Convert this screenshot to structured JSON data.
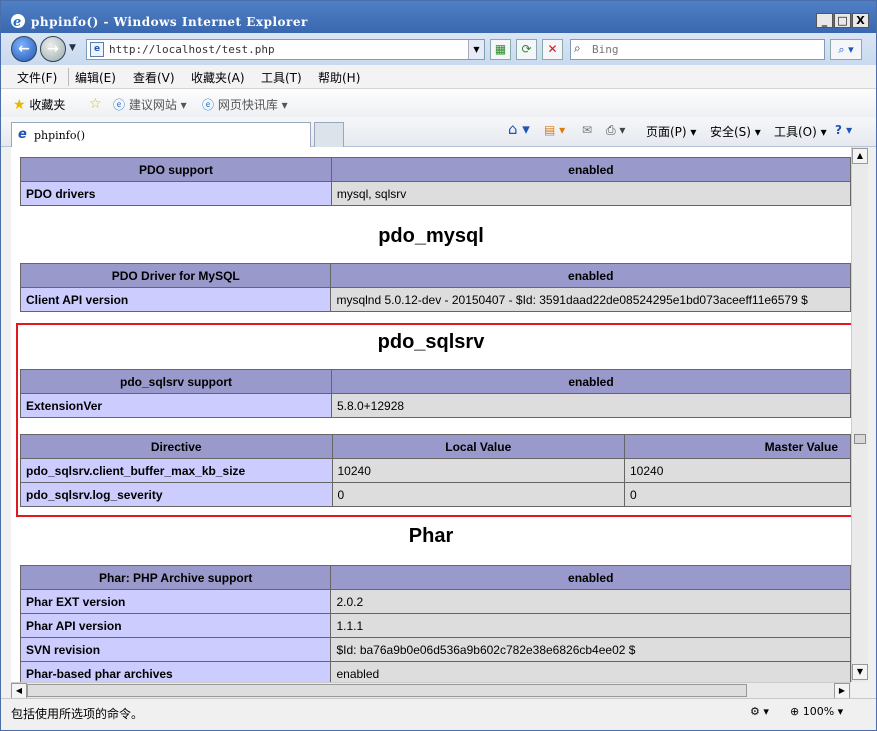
{
  "window": {
    "title": "phpinfo() - Windows Internet Explorer",
    "minimize": "_",
    "maximize": "□",
    "close": "X"
  },
  "address_bar": {
    "url": "http://localhost/test.php",
    "search_placeholder": "Bing"
  },
  "menu": [
    "文件(F)",
    "编辑(E)",
    "查看(V)",
    "收藏夹(A)",
    "工具(T)",
    "帮助(H)"
  ],
  "favorites_bar": {
    "favorites": "收藏夹",
    "suggested_sites": "建议网站 ▾",
    "web_slice": "网页快讯库 ▾"
  },
  "tab": {
    "label": "phpinfo()"
  },
  "command_bar": {
    "page": "页面(P) ▾",
    "safety": "安全(S) ▾",
    "tools": "工具(O) ▾"
  },
  "content": {
    "pdo_table": {
      "rows": [
        {
          "key": "PDO support",
          "value": "enabled",
          "header": true
        },
        {
          "key": "PDO drivers",
          "value": "mysql, sqlsrv"
        }
      ]
    },
    "pdo_mysql": {
      "heading": "pdo_mysql",
      "rows": [
        {
          "key": "PDO Driver for MySQL",
          "value": "enabled",
          "header": true
        },
        {
          "key": "Client API version",
          "value": "mysqlnd 5.0.12-dev - 20150407 - $Id: 3591daad22de08524295e1bd073aceeff11e6579 $"
        }
      ]
    },
    "pdo_sqlsrv": {
      "heading": "pdo_sqlsrv",
      "rows": [
        {
          "key": "pdo_sqlsrv support",
          "value": "enabled",
          "header": true
        },
        {
          "key": "ExtensionVer",
          "value": "5.8.0+12928"
        }
      ],
      "directives": {
        "headers": [
          "Directive",
          "Local Value",
          "Master Value"
        ],
        "rows": [
          [
            "pdo_sqlsrv.client_buffer_max_kb_size",
            "10240",
            "10240"
          ],
          [
            "pdo_sqlsrv.log_severity",
            "0",
            "0"
          ]
        ]
      }
    },
    "phar": {
      "heading": "Phar",
      "rows": [
        {
          "key": "Phar: PHP Archive support",
          "value": "enabled",
          "header": true
        },
        {
          "key": "Phar EXT version",
          "value": "2.0.2"
        },
        {
          "key": "Phar API version",
          "value": "1.1.1"
        },
        {
          "key": "SVN revision",
          "value": "$Id: ba76a9b0e06d536a9b602c782e38e6826cb4ee02 $"
        },
        {
          "key": "Phar-based phar archives",
          "value": "enabled"
        }
      ]
    }
  },
  "status_bar": {
    "text": "包括使用所选项的命令。",
    "zoom": "100%"
  },
  "colors": {
    "highlight_box": "#e2171f",
    "table_header": "#9999cc",
    "table_key": "#ccccff",
    "table_value": "#dddddd"
  }
}
